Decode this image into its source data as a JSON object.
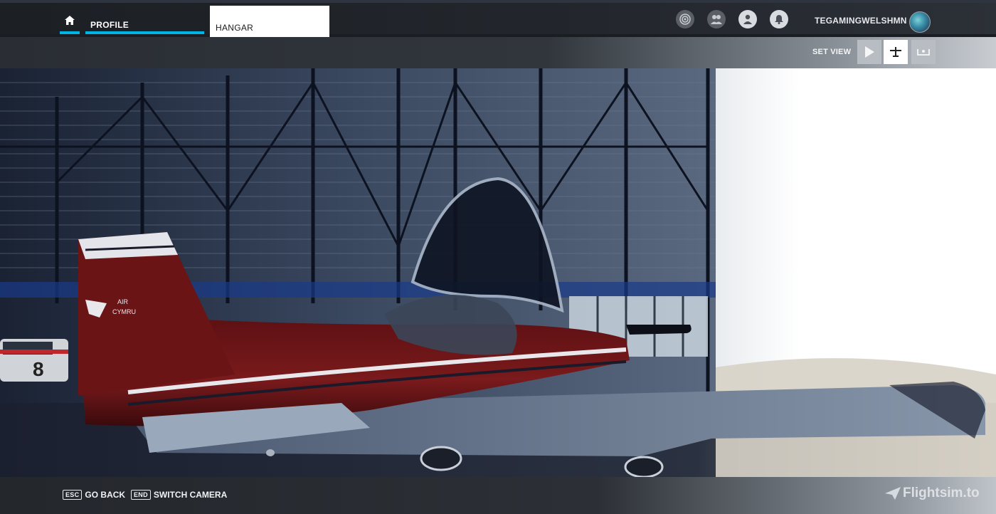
{
  "nav": {
    "home_icon": "home-icon",
    "profile_label": "PROFILE",
    "hangar_label": "HANGAR",
    "accent_color": "#00b4e6"
  },
  "header": {
    "icons": [
      "rings-icon",
      "friends-icon",
      "profile-icon",
      "notifications-icon"
    ],
    "username": "TEGAMINGWELSHMN"
  },
  "set_view": {
    "label": "SET VIEW",
    "options": [
      "play-icon",
      "aircraft-icon",
      "wings-icon"
    ],
    "selected": "aircraft-icon"
  },
  "scene": {
    "tail_text_1": "AIR",
    "tail_text_2": "CYMRU",
    "car_number": "8"
  },
  "footer": {
    "hints": [
      {
        "key": "ESC",
        "label": "GO BACK"
      },
      {
        "key": "END",
        "label": "SWITCH CAMERA"
      }
    ],
    "watermark": "Flightsim.to"
  }
}
